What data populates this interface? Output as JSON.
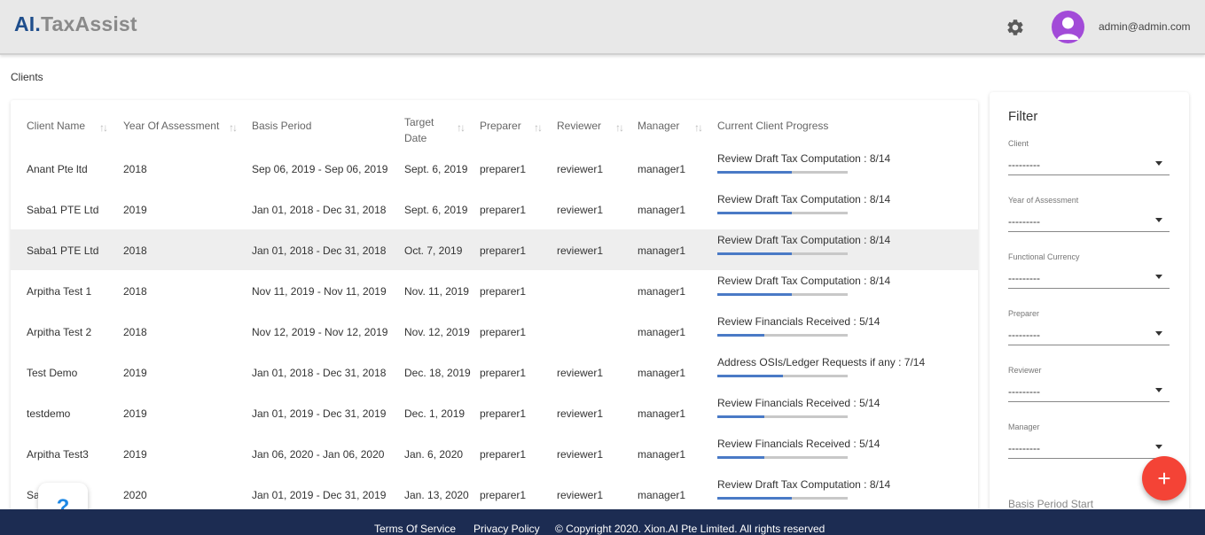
{
  "header": {
    "logo_part1": "AI.",
    "logo_part2": "TaxAssist",
    "settings_icon": "gear-icon",
    "avatar_icon": "user-avatar-icon",
    "user_email": "admin@admin.com"
  },
  "breadcrumb": "Clients",
  "table": {
    "columns": {
      "client_name": "Client Name",
      "year": "Year Of Assessment",
      "basis": "Basis Period",
      "target_line1": "Target",
      "target_line2": "Date",
      "preparer": "Preparer",
      "reviewer": "Reviewer",
      "manager": "Manager",
      "progress": "Current Client Progress"
    },
    "rows": [
      {
        "client": "Anant Pte ltd",
        "year": "2018",
        "basis": "Sep 06, 2019 - Sep 06, 2019",
        "target": "Sept. 6, 2019",
        "preparer": "preparer1",
        "reviewer": "reviewer1",
        "manager": "manager1",
        "progress": "Review Draft Tax Computation : 8/14",
        "step": 8,
        "total": 14
      },
      {
        "client": "Saba1 PTE Ltd",
        "year": "2019",
        "basis": "Jan 01, 2018 - Dec 31, 2018",
        "target": "Sept. 6, 2019",
        "preparer": "preparer1",
        "reviewer": "reviewer1",
        "manager": "manager1",
        "progress": "Review Draft Tax Computation : 8/14",
        "step": 8,
        "total": 14
      },
      {
        "client": "Saba1 PTE Ltd",
        "year": "2018",
        "basis": "Jan 01, 2018 - Dec 31, 2018",
        "target": "Oct. 7, 2019",
        "preparer": "preparer1",
        "reviewer": "reviewer1",
        "manager": "manager1",
        "progress": "Review Draft Tax Computation : 8/14",
        "step": 8,
        "total": 14
      },
      {
        "client": "Arpitha Test 1",
        "year": "2018",
        "basis": "Nov 11, 2019 - Nov 11, 2019",
        "target": "Nov. 11, 2019",
        "preparer": "preparer1",
        "reviewer": "",
        "manager": "manager1",
        "progress": "Review Draft Tax Computation : 8/14",
        "step": 8,
        "total": 14
      },
      {
        "client": "Arpitha Test 2",
        "year": "2018",
        "basis": "Nov 12, 2019 - Nov 12, 2019",
        "target": "Nov. 12, 2019",
        "preparer": "preparer1",
        "reviewer": "",
        "manager": "manager1",
        "progress": "Review Financials Received : 5/14",
        "step": 5,
        "total": 14
      },
      {
        "client": "Test Demo",
        "year": "2019",
        "basis": "Jan 01, 2018 - Dec 31, 2018",
        "target": "Dec. 18, 2019",
        "preparer": "preparer1",
        "reviewer": "reviewer1",
        "manager": "manager1",
        "progress": "Address OSIs/Ledger Requests if any : 7/14",
        "step": 7,
        "total": 14
      },
      {
        "client": "testdemo",
        "year": "2019",
        "basis": "Jan 01, 2019 - Dec 31, 2019",
        "target": "Dec. 1, 2019",
        "preparer": "preparer1",
        "reviewer": "reviewer1",
        "manager": "manager1",
        "progress": "Review Financials Received : 5/14",
        "step": 5,
        "total": 14
      },
      {
        "client": "Arpitha Test3",
        "year": "2019",
        "basis": "Jan 06, 2020 - Jan 06, 2020",
        "target": "Jan. 6, 2020",
        "preparer": "preparer1",
        "reviewer": "reviewer1",
        "manager": "manager1",
        "progress": "Review Financials Received : 5/14",
        "step": 5,
        "total": 14
      },
      {
        "client": "Sa  Ltd",
        "year": "2020",
        "basis": "Jan 01, 2019 - Dec 31, 2019",
        "target": "Jan. 13, 2020",
        "preparer": "preparer1",
        "reviewer": "reviewer1",
        "manager": "manager1",
        "progress": "Review Draft Tax Computation : 8/14",
        "step": 8,
        "total": 14
      }
    ]
  },
  "filter": {
    "title": "Filter",
    "fields": [
      {
        "label": "Client",
        "value": "---------"
      },
      {
        "label": "Year of Assessment",
        "value": "---------"
      },
      {
        "label": "Functional Currency",
        "value": "---------"
      },
      {
        "label": "Preparer",
        "value": "---------"
      },
      {
        "label": "Reviewer",
        "value": "---------"
      },
      {
        "label": "Manager",
        "value": "---------"
      }
    ],
    "partial_label": "Basis Period Start"
  },
  "fab_label": "+",
  "help_label": "?",
  "footer": {
    "terms": "Terms Of Service",
    "privacy": "Privacy Policy",
    "copyright": "© Copyright 2020. Xion.AI Pte Limited. All rights reserved"
  },
  "colors": {
    "accent": "#4a7ac6",
    "fab": "#f44336",
    "footer": "#1c2c52",
    "avatar": "#a24bd8"
  }
}
